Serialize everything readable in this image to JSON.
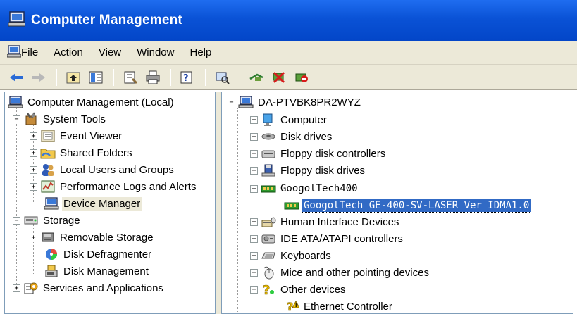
{
  "window": {
    "title": "Computer Management"
  },
  "menu": [
    "File",
    "Action",
    "View",
    "Window",
    "Help"
  ],
  "left_tree": {
    "root": "Computer Management (Local)",
    "system_tools": "System Tools",
    "event_viewer": "Event Viewer",
    "shared_folders": "Shared Folders",
    "local_users": "Local Users and Groups",
    "perf_logs": "Performance Logs and Alerts",
    "device_manager": "Device Manager",
    "storage": "Storage",
    "removable_storage": "Removable Storage",
    "disk_defrag": "Disk Defragmenter",
    "disk_mgmt": "Disk Management",
    "services_apps": "Services and Applications"
  },
  "right_tree": {
    "root": "DA-PTVBK8PR2WYZ",
    "computer": "Computer",
    "disk_drives": "Disk drives",
    "floppy_ctrl": "Floppy disk controllers",
    "floppy_drives": "Floppy disk drives",
    "googoltech": "GoogolTech400",
    "googoltech_device": "GoogolTech GE-400-SV-LASER Ver IDMA1.0",
    "hid": "Human Interface Devices",
    "ide": "IDE ATA/ATAPI controllers",
    "keyboards": "Keyboards",
    "mice": "Mice and other pointing devices",
    "other_devices": "Other devices",
    "ethernet": "Ethernet Controller"
  },
  "colors": {
    "title_bar": "#0a52d6",
    "selection": "#316ac5",
    "chrome": "#ece9d8"
  }
}
